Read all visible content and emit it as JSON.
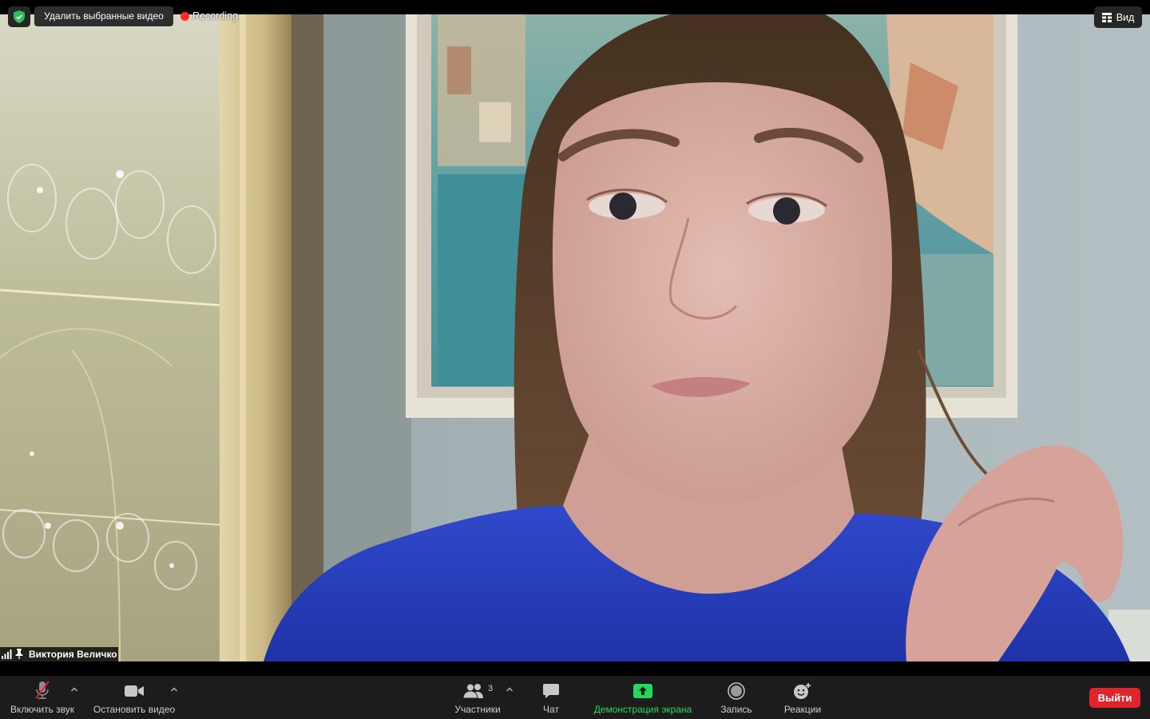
{
  "top_bar": {
    "delete_selected_videos_label": "Удалить выбранные видео",
    "recording_label": "Recording",
    "view_label": "Вид"
  },
  "video": {
    "participant_name": "Виктория Величко"
  },
  "toolbar": {
    "unmute_label": "Включить звук",
    "stop_video_label": "Остановить видео",
    "participants_label": "Участники",
    "participants_count": "3",
    "chat_label": "Чат",
    "share_screen_label": "Демонстрация экрана",
    "record_label": "Запись",
    "reactions_label": "Реакции",
    "leave_label": "Выйти"
  },
  "icons": {
    "security": "security-shield-icon",
    "recording": "recording-dot-icon",
    "view": "grid-view-icon",
    "signal": "signal-strength-icon",
    "pin": "pin-icon",
    "microphone": "microphone-muted-icon",
    "camera": "video-camera-icon",
    "participants": "participants-icon",
    "chat": "chat-bubble-icon",
    "share": "share-screen-icon",
    "record": "record-icon",
    "reactions": "reactions-icon",
    "menu_caret": "chevron-up-icon"
  },
  "colors": {
    "share_accent": "#23d95b",
    "leave_button": "#e0242a",
    "recording_dot": "#ff2a2a",
    "security_shield": "#2dbe5a",
    "mute_slash": "#e0242a",
    "toolbar_background": "#1c1c1c"
  }
}
